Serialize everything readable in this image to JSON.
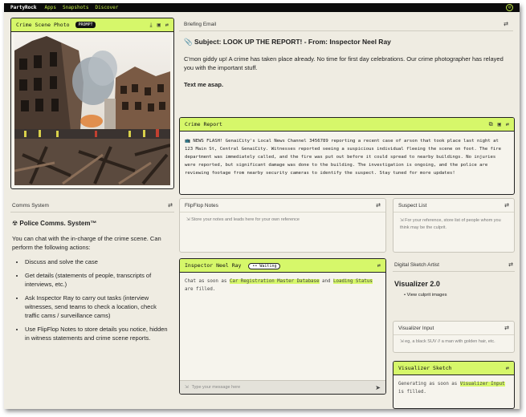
{
  "topbar": {
    "brand": "PartyRock",
    "nav": [
      "Apps",
      "Snapshots",
      "Discover"
    ]
  },
  "crime_photo": {
    "title": "Crime Scene Photo",
    "badge": "PROMPT"
  },
  "briefing": {
    "title": "Briefing Email",
    "subject": "📎 Subject: LOOK UP THE REPORT! - From: Inspector Neel Ray",
    "body": "C'mon giddy up! A crime has taken place already. No time for first day celebrations. Our crime photographer has relayed you with the important stuff.",
    "closing": "Text me asap."
  },
  "crime_report": {
    "title": "Crime Report",
    "text": "📺 NEWS FLASH! GenaiCity's Local News Channel 3456789 reporting a recent case of arson that took place last night at 123 Main St, Central GenaiCity. Witnesses reported seeing a suspicious individual fleeing the scene on foot. The fire department was immediately called, and the fire was put out before it could spread to nearby buildings. No injuries were reported, but significant damage was done to the building. The investigation is ongoing, and the police are reviewing footage from nearby security cameras to identify the suspect. Stay tuned for more updates!"
  },
  "comms": {
    "title": "Comms System",
    "heading": "☢ Police Comms. System™",
    "intro": "You can chat with the in-charge of the crime scene. Can perform the following actions:",
    "actions": [
      "Discuss and solve the case",
      "Get details (statements of people, transcripts of interviews, etc.)",
      "Ask Inspector Ray to carry out tasks (interview witnesses, send teams to check a location, check traffic cams / surveillance cams)",
      "Use FlipFlop Notes to store details you notice, hidden in witness statements and crime scene reports."
    ]
  },
  "flipflop": {
    "title": "FlipFlop Notes",
    "placeholder": "Store your notes and leads here for your own reference"
  },
  "suspects": {
    "title": "Suspect List",
    "placeholder": "For your reference, store list of people whom you think may be the culprit."
  },
  "inspector": {
    "title": "Inspector Neel Ray",
    "status": "•• Waiting",
    "msg_pre": "Chat as soon as ",
    "msg_hl1": "Car Registration Master Database",
    "msg_mid": " and ",
    "msg_hl2": "Loading Status",
    "msg_post": " are filled.",
    "input_placeholder": "Type your message here"
  },
  "sketch_artist": {
    "title": "Digital Sketch Artist",
    "heading": "Visualizer 2.0",
    "bullet": "View culprit images"
  },
  "visualizer_input": {
    "title": "Visualizer Input",
    "placeholder": "eg, a black SUV // a man with golden hair, etc."
  },
  "visualizer_sketch": {
    "title": "Visualizer Sketch",
    "msg_pre": "Generating as soon as ",
    "msg_hl": "Visualizer Input",
    "msg_post": " is filled."
  },
  "colors": {
    "accent": "#d6f76a",
    "background": "#efece2",
    "topbar": "#0b0b0b"
  }
}
